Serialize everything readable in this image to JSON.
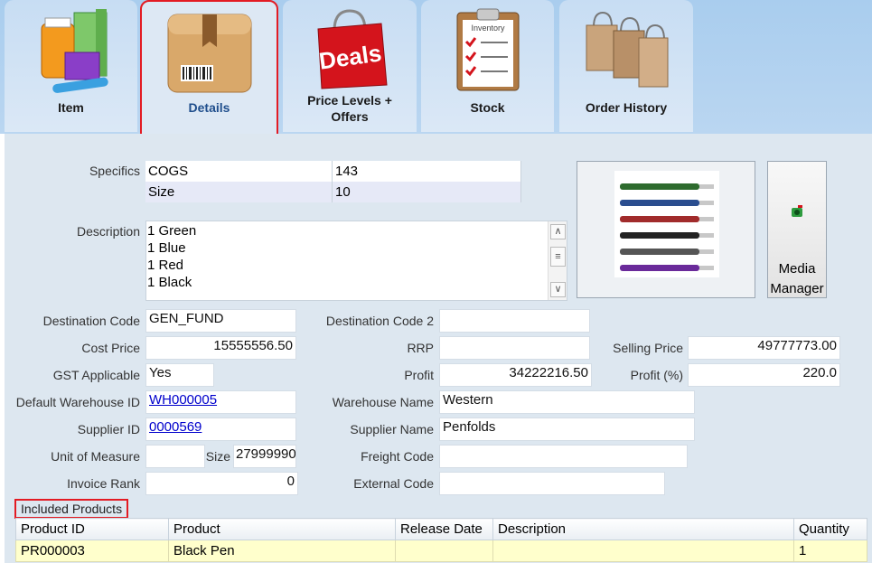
{
  "tabs": [
    {
      "label": "Item",
      "active": false
    },
    {
      "label": "Details",
      "active": true
    },
    {
      "label": "Price Levels + Offers",
      "active": false
    },
    {
      "label": "Stock",
      "active": false
    },
    {
      "label": "Order History",
      "active": false
    }
  ],
  "deals_text": "Deals",
  "inventory_text": "Inventory",
  "specifics": {
    "label": "Specifics",
    "rows": [
      {
        "name": "COGS",
        "value": "143"
      },
      {
        "name": "Size",
        "value": "10"
      }
    ]
  },
  "description": {
    "label": "Description",
    "text": "1 Green\n1 Blue\n1 Red\n1 Black"
  },
  "media_manager_label": "Media Manager",
  "fields": {
    "destination_code": {
      "label": "Destination Code",
      "value": "GEN_FUND"
    },
    "destination_code_2": {
      "label": "Destination Code 2",
      "value": ""
    },
    "cost_price": {
      "label": "Cost Price",
      "value": "15555556.50"
    },
    "rrp": {
      "label": "RRP",
      "value": ""
    },
    "selling_price": {
      "label": "Selling Price",
      "value": "49777773.00"
    },
    "gst_applicable": {
      "label": "GST Applicable",
      "value": "Yes"
    },
    "profit": {
      "label": "Profit",
      "value": "34222216.50"
    },
    "profit_pct": {
      "label": "Profit (%)",
      "value": "220.0"
    },
    "default_warehouse_id": {
      "label": "Default Warehouse ID",
      "value": "WH000005"
    },
    "warehouse_name": {
      "label": "Warehouse Name",
      "value": "Western"
    },
    "supplier_id": {
      "label": "Supplier ID",
      "value": "0000569"
    },
    "supplier_name": {
      "label": "Supplier Name",
      "value": "Penfolds"
    },
    "unit_of_measure": {
      "label": "Unit of Measure",
      "value": ""
    },
    "size": {
      "label": "Size",
      "value": "27999990"
    },
    "freight_code": {
      "label": "Freight Code",
      "value": ""
    },
    "invoice_rank": {
      "label": "Invoice Rank",
      "value": "0"
    },
    "external_code": {
      "label": "External Code",
      "value": ""
    }
  },
  "included_products": {
    "label": "Included Products",
    "columns": [
      "Product ID",
      "Product",
      "Release Date",
      "Description",
      "Quantity"
    ],
    "rows": [
      {
        "product_id": "PR000003",
        "product": "Black Pen",
        "release_date": "",
        "description": "",
        "quantity": "1"
      }
    ]
  },
  "pen_colors": [
    "#2e6b2e",
    "#2a4d8f",
    "#a12b2b",
    "#222222",
    "#555555",
    "#6a2a9a"
  ]
}
